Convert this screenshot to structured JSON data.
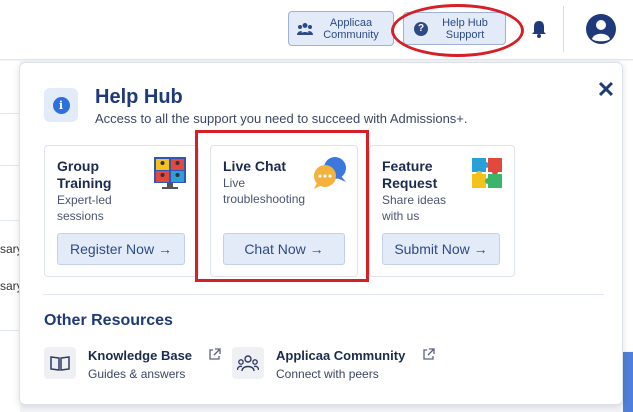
{
  "topbar": {
    "community_label": "Applicaa Community",
    "helphub_label": "Help Hub Support"
  },
  "background": {
    "row1_text": "sary",
    "row2_text": "sary"
  },
  "panel": {
    "title": "Help Hub",
    "subtitle": "Access to all the support you need to succeed with Admissions+.",
    "close_label": "✕",
    "cards": [
      {
        "title_line1": "Group",
        "title_line2": "Training",
        "desc_line1": "Expert-led",
        "desc_line2": "sessions",
        "button": "Register Now →"
      },
      {
        "title_line1": "Live Chat",
        "desc_line1": "Live",
        "desc_line2": "troubleshooting",
        "button": "Chat Now →"
      },
      {
        "title_line1": "Feature",
        "title_line2": "Request",
        "desc_line1": "Share ideas",
        "desc_line2": "with us",
        "button": "Submit Now →"
      }
    ],
    "other_resources_title": "Other Resources",
    "resources": [
      {
        "title": "Knowledge Base",
        "subtitle": "Guides & answers"
      },
      {
        "title": "Applicaa Community",
        "subtitle": "Connect with peers"
      }
    ]
  },
  "colors": {
    "accent": "#2d4a86",
    "highlight": "#d61f26",
    "title": "#1f3a7a"
  }
}
